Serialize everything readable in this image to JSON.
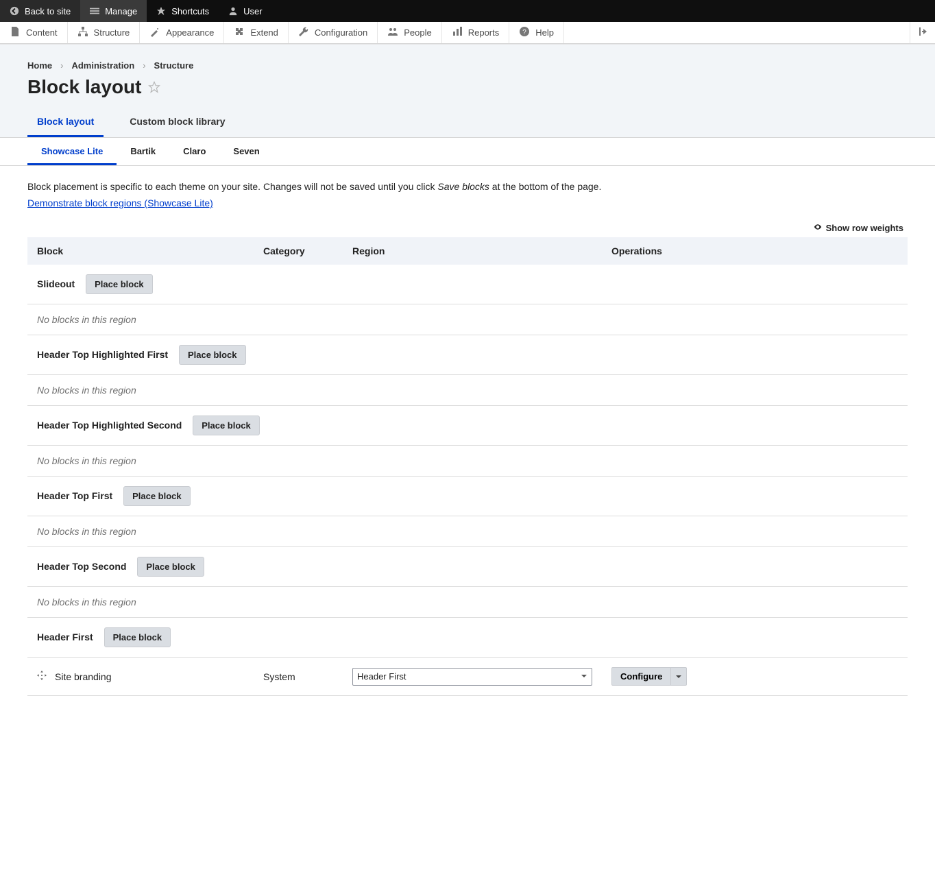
{
  "toolbar": {
    "back": "Back to site",
    "manage": "Manage",
    "shortcuts": "Shortcuts",
    "user": "User"
  },
  "admin_menu": {
    "items": [
      {
        "label": "Content",
        "icon": "file"
      },
      {
        "label": "Structure",
        "icon": "sitemap"
      },
      {
        "label": "Appearance",
        "icon": "wand"
      },
      {
        "label": "Extend",
        "icon": "puzzle"
      },
      {
        "label": "Configuration",
        "icon": "wrench"
      },
      {
        "label": "People",
        "icon": "people"
      },
      {
        "label": "Reports",
        "icon": "bars"
      },
      {
        "label": "Help",
        "icon": "help"
      }
    ]
  },
  "breadcrumb": [
    "Home",
    "Administration",
    "Structure"
  ],
  "page_title": "Block layout",
  "primary_tabs": [
    {
      "label": "Block layout",
      "active": true
    },
    {
      "label": "Custom block library",
      "active": false
    }
  ],
  "secondary_tabs": [
    {
      "label": "Showcase Lite",
      "active": true
    },
    {
      "label": "Bartik",
      "active": false
    },
    {
      "label": "Claro",
      "active": false
    },
    {
      "label": "Seven",
      "active": false
    }
  ],
  "intro": {
    "prefix": "Block placement is specific to each theme on your site. Changes will not be saved until you click ",
    "emph": "Save blocks",
    "suffix": " at the bottom of the page."
  },
  "demo_link": "Demonstrate block regions (Showcase Lite)",
  "show_row_weights": "Show row weights",
  "table": {
    "headers": {
      "block": "Block",
      "category": "Category",
      "region": "Region",
      "operations": "Operations"
    },
    "place_block": "Place block",
    "no_blocks": "No blocks in this region",
    "configure": "Configure",
    "regions": [
      {
        "name": "Slideout",
        "blocks": []
      },
      {
        "name": "Header Top Highlighted First",
        "blocks": []
      },
      {
        "name": "Header Top Highlighted Second",
        "blocks": []
      },
      {
        "name": "Header Top First",
        "blocks": []
      },
      {
        "name": "Header Top Second",
        "blocks": []
      },
      {
        "name": "Header First",
        "blocks": [
          {
            "name": "Site branding",
            "category": "System",
            "region": "Header First"
          }
        ]
      }
    ]
  }
}
